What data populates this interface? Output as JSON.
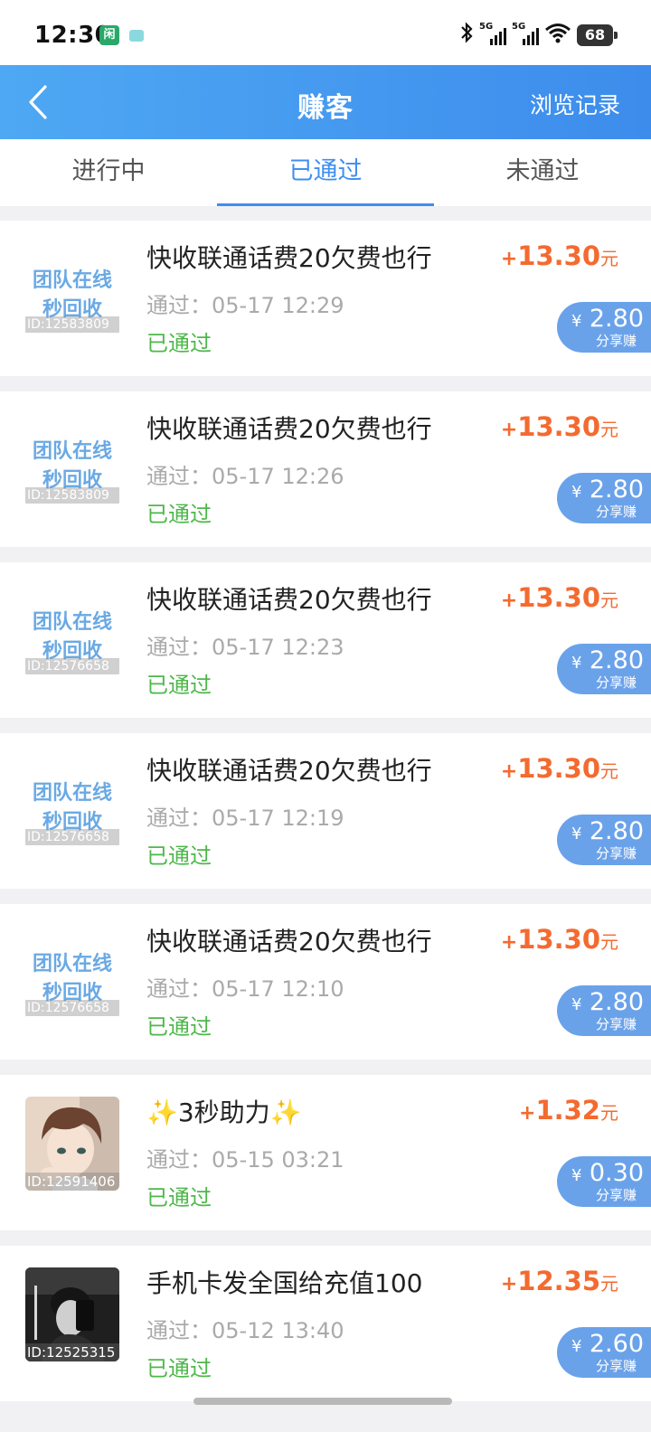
{
  "status_bar": {
    "time": "12:30",
    "app_badge": "闲",
    "network_label": "5G",
    "battery": "68"
  },
  "header": {
    "title": "赚客",
    "history": "浏览记录"
  },
  "tabs": [
    {
      "label": "进行中",
      "active": false
    },
    {
      "label": "已通过",
      "active": true
    },
    {
      "label": "未通过",
      "active": false
    }
  ],
  "items": [
    {
      "title": "快收联通话费20欠费也行",
      "time": "通过：05-17 12:29",
      "status": "已通过",
      "amount_sign": "+",
      "amount": "13.30",
      "unit": "元",
      "share_currency": "¥",
      "share_value": "2.80",
      "share_label": "分享赚",
      "logo_line1": "团队在线",
      "logo_line2": "秒回收",
      "id": "ID:12583809",
      "thumb": "text-logo"
    },
    {
      "title": "快收联通话费20欠费也行",
      "time": "通过：05-17 12:26",
      "status": "已通过",
      "amount_sign": "+",
      "amount": "13.30",
      "unit": "元",
      "share_currency": "¥",
      "share_value": "2.80",
      "share_label": "分享赚",
      "logo_line1": "团队在线",
      "logo_line2": "秒回收",
      "id": "ID:12583809",
      "thumb": "text-logo"
    },
    {
      "title": "快收联通话费20欠费也行",
      "time": "通过：05-17 12:23",
      "status": "已通过",
      "amount_sign": "+",
      "amount": "13.30",
      "unit": "元",
      "share_currency": "¥",
      "share_value": "2.80",
      "share_label": "分享赚",
      "logo_line1": "团队在线",
      "logo_line2": "秒回收",
      "id": "ID:12576658",
      "thumb": "text-logo"
    },
    {
      "title": "快收联通话费20欠费也行",
      "time": "通过：05-17 12:19",
      "status": "已通过",
      "amount_sign": "+",
      "amount": "13.30",
      "unit": "元",
      "share_currency": "¥",
      "share_value": "2.80",
      "share_label": "分享赚",
      "logo_line1": "团队在线",
      "logo_line2": "秒回收",
      "id": "ID:12576658",
      "thumb": "text-logo"
    },
    {
      "title": "快收联通话费20欠费也行",
      "time": "通过：05-17 12:10",
      "status": "已通过",
      "amount_sign": "+",
      "amount": "13.30",
      "unit": "元",
      "share_currency": "¥",
      "share_value": "2.80",
      "share_label": "分享赚",
      "logo_line1": "团队在线",
      "logo_line2": "秒回收",
      "id": "ID:12576658",
      "thumb": "text-logo"
    },
    {
      "title": "✨3秒助力✨",
      "time": "通过：05-15 03:21",
      "status": "已通过",
      "amount_sign": "+",
      "amount": "1.32",
      "unit": "元",
      "share_currency": "¥",
      "share_value": "0.30",
      "share_label": "分享赚",
      "id": "ID:12591406",
      "thumb": "anime-avatar"
    },
    {
      "title": "手机卡发全国给充值100",
      "time": "通过：05-12 13:40",
      "status": "已通过",
      "amount_sign": "+",
      "amount": "12.35",
      "unit": "元",
      "share_currency": "¥",
      "share_value": "2.60",
      "share_label": "分享赚",
      "id": "ID:12525315",
      "thumb": "photo-avatar"
    }
  ]
}
